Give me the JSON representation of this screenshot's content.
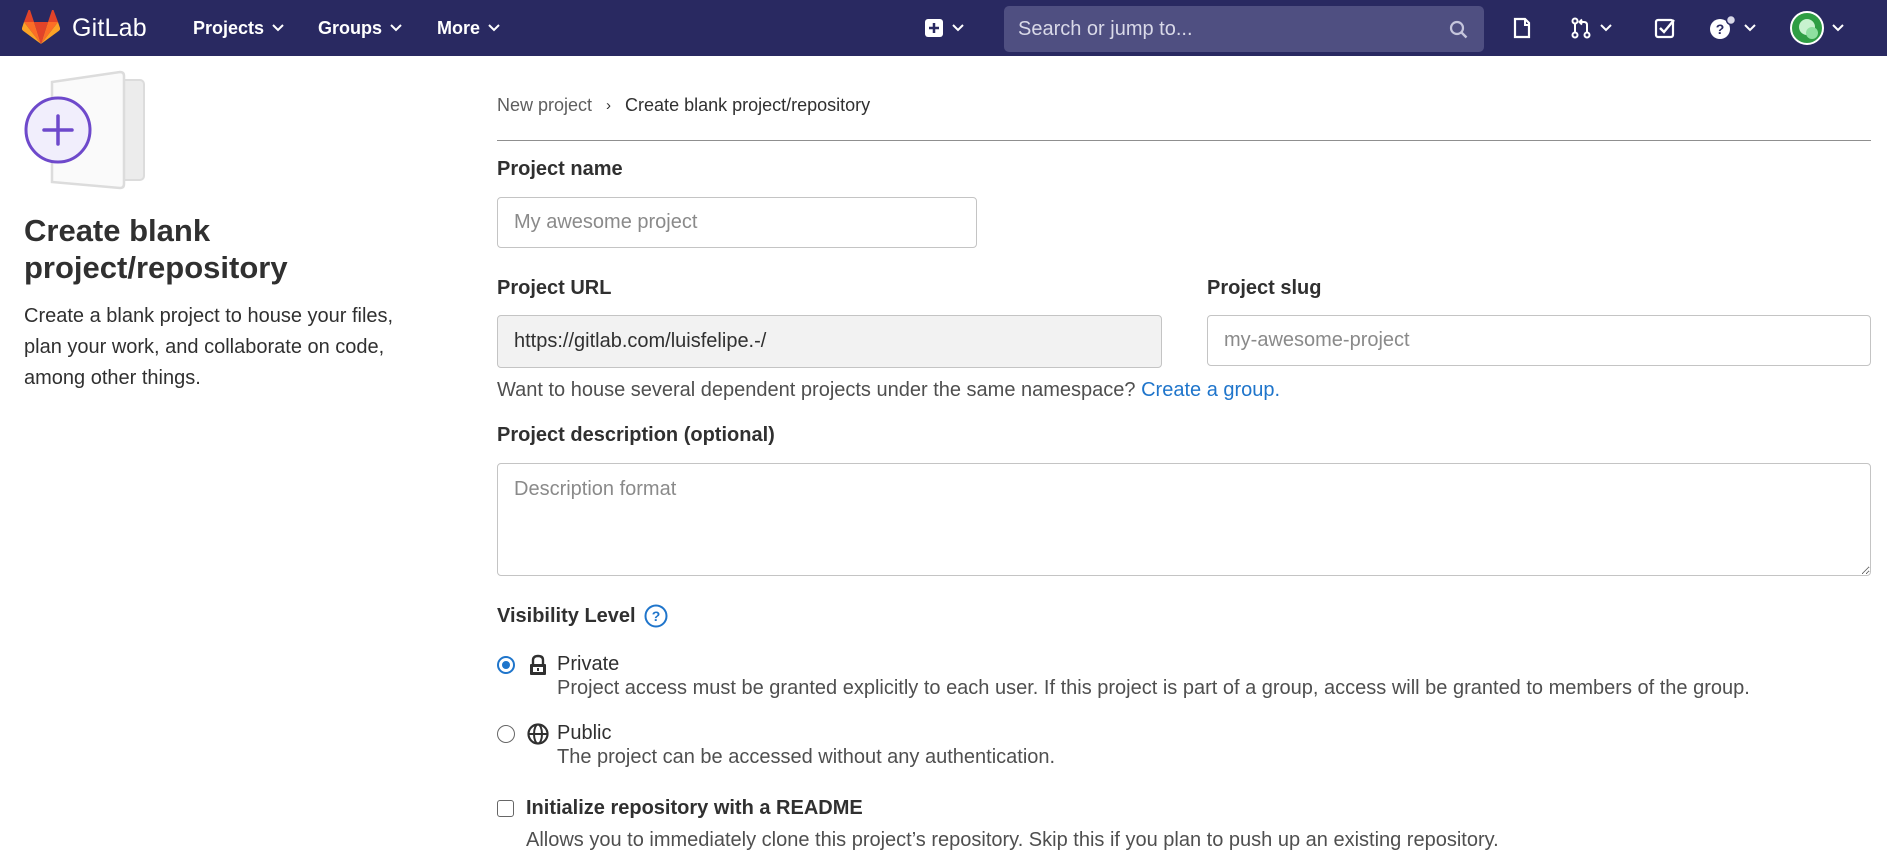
{
  "navbar": {
    "brand": "GitLab",
    "menus": [
      "Projects",
      "Groups",
      "More"
    ],
    "search_placeholder": "Search or jump to...",
    "colors": {
      "background": "#292961",
      "search": "#4f4f81"
    },
    "icons": [
      "plus-square-icon",
      "issues-icon",
      "merge-request-icon",
      "todo-icon",
      "help-icon",
      "user-avatar"
    ]
  },
  "left": {
    "title": "Create blank project/repository",
    "description": "Create a blank project to house your files, plan your work, and collaborate on code, among other things."
  },
  "breadcrumb": {
    "parent": "New project",
    "separator": "›",
    "current": "Create blank project/repository"
  },
  "form": {
    "project_name_label": "Project name",
    "project_name_placeholder": "My awesome project",
    "project_url_label": "Project URL",
    "project_url_value": "https://gitlab.com/luisfelipe.-/",
    "project_slug_label": "Project slug",
    "project_slug_placeholder": "my-awesome-project",
    "namespace_help": "Want to house several dependent projects under the same namespace?",
    "create_group_link": "Create a group.",
    "description_label": "Project description (optional)",
    "description_placeholder": "Description format",
    "visibility_label": "Visibility Level",
    "visibility_options": [
      {
        "title": "Private",
        "description": "Project access must be granted explicitly to each user. If this project is part of a group, access will be granted to members of the group.",
        "selected": true
      },
      {
        "title": "Public",
        "description": "The project can be accessed without any authentication.",
        "selected": false
      }
    ],
    "readme_label": "Initialize repository with a README",
    "readme_description": "Allows you to immediately clone this project’s repository. Skip this if you plan to push up an existing repository."
  },
  "colors": {
    "link": "#1f75cb",
    "accent_purple": "#6e49cb"
  }
}
